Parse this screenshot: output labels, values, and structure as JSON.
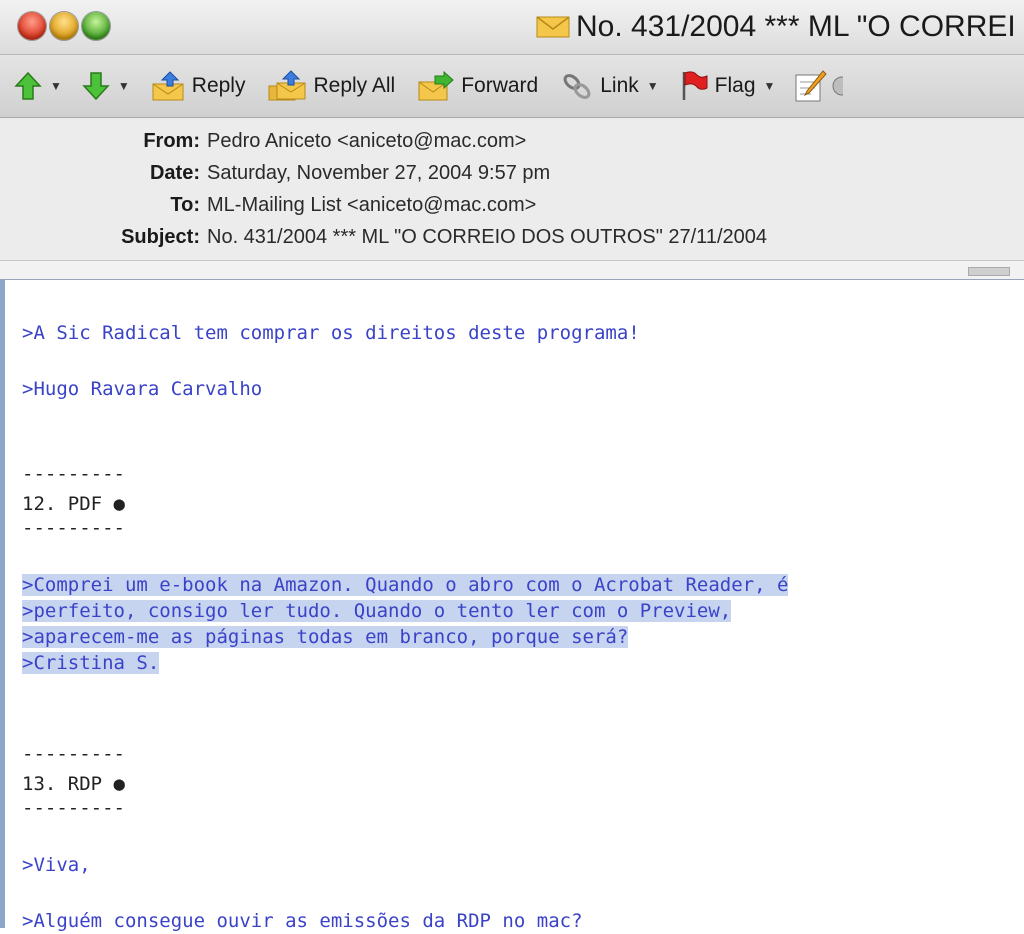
{
  "window": {
    "title": "No. 431/2004 *** ML \"O CORREI"
  },
  "toolbar": {
    "previous_label": "",
    "next_label": "",
    "reply_label": "Reply",
    "reply_all_label": "Reply All",
    "forward_label": "Forward",
    "link_label": "Link",
    "flag_label": "Flag"
  },
  "headers": {
    "from_key": "From:",
    "from_value": "Pedro Aniceto <aniceto@mac.com>",
    "date_key": "Date:",
    "date_value": "Saturday, November 27, 2004 9:57 pm",
    "to_key": "To:",
    "to_value": "ML-Mailing List <aniceto@mac.com>",
    "subject_key": "Subject:",
    "subject_value": "No. 431/2004 *** ML \"O CORREIO DOS OUTROS\" 27/11/2004"
  },
  "body": {
    "line_1": ">A Sic Radical tem comprar os direitos deste programa!",
    "line_2": ">Hugo Ravara Carvalho",
    "sep_1": "---------",
    "section_12": "12. PDF ",
    "sep_2": "---------",
    "sel_1": ">Comprei um e-book na Amazon. Quando o abro com o Acrobat Reader, é",
    "sel_2": ">perfeito, consigo ler tudo. Quando o tento ler com o Preview,",
    "sel_3": ">aparecem-me as páginas todas em branco, porque será?",
    "sel_4": ">Cristina S.",
    "sep_3": "---------",
    "section_13": "13. RDP ",
    "sep_4": "---------",
    "line_3": ">Viva,",
    "line_4": ">Alguém consegue ouvir as emissões da RDP no mac?"
  },
  "colors": {
    "quote_text": "#3a43c8",
    "selection": "#c6d4f0",
    "body_border": "#8da6c8"
  }
}
